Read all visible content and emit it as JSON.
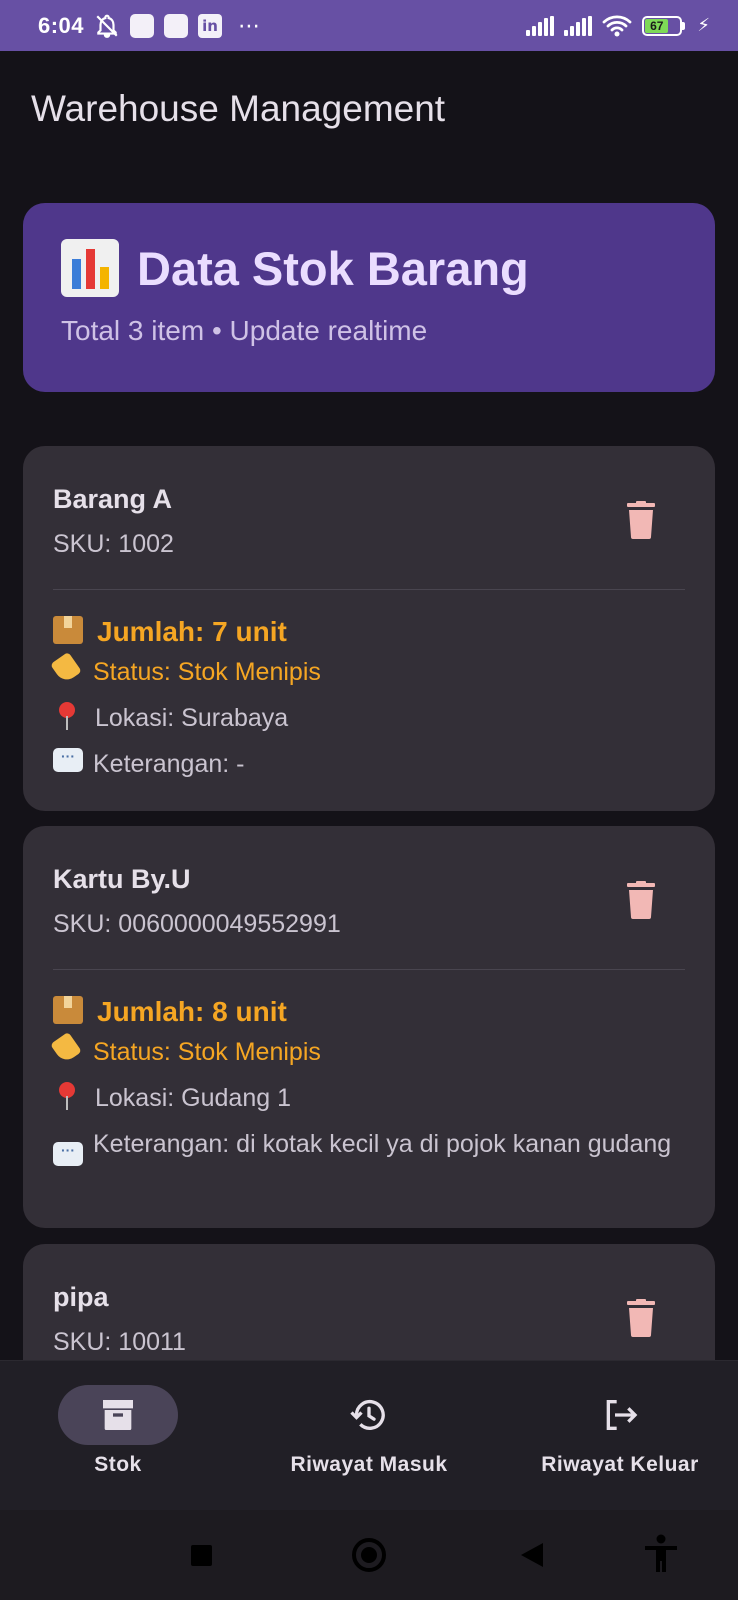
{
  "status_bar": {
    "time": "6:04",
    "battery": "67",
    "overflow": "⋯",
    "icons": [
      "bell-off-icon",
      "notification-square-icon",
      "notification-square-icon",
      "linkedin-icon",
      "signal-icon",
      "signal-icon",
      "wifi-icon",
      "battery-icon",
      "charging-icon"
    ]
  },
  "app_bar": {
    "title": "Warehouse Management"
  },
  "header": {
    "icon": "bar-chart-icon",
    "title": "Data Stok Barang",
    "subtitle": "Total 3 item • Update realtime",
    "color": "#4f378b"
  },
  "items": [
    {
      "name": "Barang A",
      "sku": "SKU: 1002",
      "qty": "Jumlah: 7 unit",
      "status": "Status: Stok Menipis",
      "location": "Lokasi: Surabaya",
      "note": "Keterangan: -"
    },
    {
      "name": "Kartu By.U",
      "sku": "SKU: 0060000049552991",
      "qty": "Jumlah: 8 unit",
      "status": "Status: Stok Menipis",
      "location": "Lokasi: Gudang 1",
      "note": "Keterangan: di kotak kecil ya di pojok kanan gudang"
    },
    {
      "name": "pipa",
      "sku": "SKU: 10011"
    }
  ],
  "bottom_nav": {
    "items": [
      {
        "label": "Stok",
        "icon": "archive-icon",
        "active": true
      },
      {
        "label": "Riwayat Masuk",
        "icon": "history-icon",
        "active": false
      },
      {
        "label": "Riwayat Keluar",
        "icon": "logout-icon",
        "active": false
      }
    ]
  },
  "colors": {
    "accent": "#6750a4",
    "warning": "#f5a623",
    "delete": "#f2b8b5",
    "surface": "#332f37",
    "background": "#141218"
  }
}
